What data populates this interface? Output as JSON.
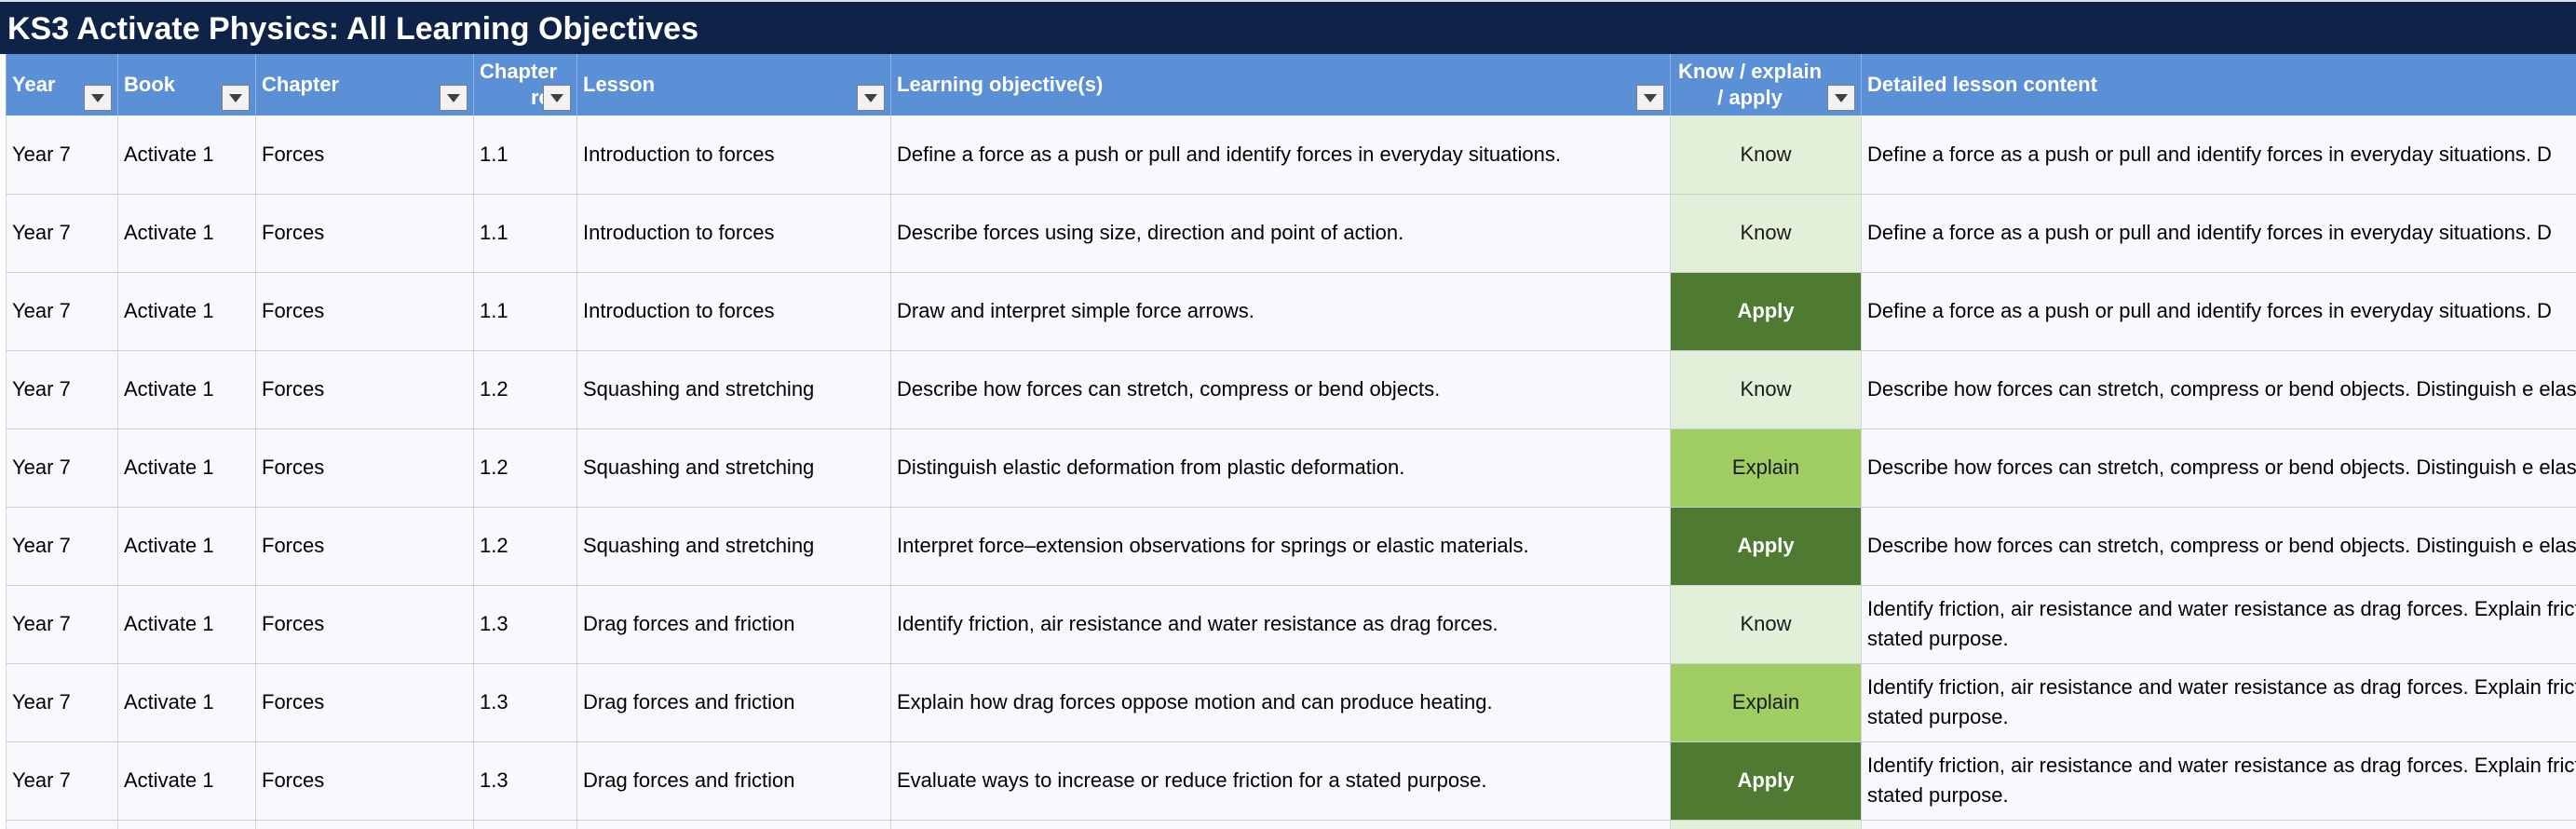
{
  "sheet_title": "KS3 Activate Physics: All Learning Objectives",
  "headers": {
    "year": "Year",
    "book": "Book",
    "chapter": "Chapter",
    "chapter_ref": "Chapter ref",
    "lesson": "Lesson",
    "objective": "Learning objective(s)",
    "kea": "Know / explain / apply",
    "detail": "Detailed lesson content"
  },
  "colors": {
    "title_bg": "#0e2347",
    "header_bg": "#5b8fd6",
    "know_bg": "#e2efd9",
    "explain_bg": "#9fcd63",
    "apply_bg": "#4e7a32"
  },
  "rows": [
    {
      "year": "Year 7",
      "book": "Activate 1",
      "chapter": "Forces",
      "ref": "1.1",
      "lesson": "Introduction to forces",
      "objective": "Define a force as a push or pull and identify forces in everyday situations.",
      "kea": "Know",
      "detail": "Define a force as a push or pull and identify forces in everyday situations. D"
    },
    {
      "year": "Year 7",
      "book": "Activate 1",
      "chapter": "Forces",
      "ref": "1.1",
      "lesson": "Introduction to forces",
      "objective": "Describe forces using size, direction and point of action.",
      "kea": "Know",
      "detail": "Define a force as a push or pull and identify forces in everyday situations. D"
    },
    {
      "year": "Year 7",
      "book": "Activate 1",
      "chapter": "Forces",
      "ref": "1.1",
      "lesson": "Introduction to forces",
      "objective": "Draw and interpret simple force arrows.",
      "kea": "Apply",
      "detail": "Define a force as a push or pull and identify forces in everyday situations. D"
    },
    {
      "year": "Year 7",
      "book": "Activate 1",
      "chapter": "Forces",
      "ref": "1.2",
      "lesson": "Squashing and stretching",
      "objective": "Describe how forces can stretch, compress or bend objects.",
      "kea": "Know",
      "detail": "Describe how forces can stretch, compress or bend objects. Distinguish e elastic materials."
    },
    {
      "year": "Year 7",
      "book": "Activate 1",
      "chapter": "Forces",
      "ref": "1.2",
      "lesson": "Squashing and stretching",
      "objective": "Distinguish elastic deformation from plastic deformation.",
      "kea": "Explain",
      "detail": "Describe how forces can stretch, compress or bend objects. Distinguish e elastic materials."
    },
    {
      "year": "Year 7",
      "book": "Activate 1",
      "chapter": "Forces",
      "ref": "1.2",
      "lesson": "Squashing and stretching",
      "objective": "Interpret force–extension observations for springs or elastic materials.",
      "kea": "Apply",
      "detail": "Describe how forces can stretch, compress or bend objects. Distinguish e elastic materials."
    },
    {
      "year": "Year 7",
      "book": "Activate 1",
      "chapter": "Forces",
      "ref": "1.3",
      "lesson": "Drag forces and friction",
      "objective": "Identify friction, air resistance and water resistance as drag forces.",
      "kea": "Know",
      "detail": "Identify friction, air resistance and water resistance as drag forces. Explain friction for a stated purpose."
    },
    {
      "year": "Year 7",
      "book": "Activate 1",
      "chapter": "Forces",
      "ref": "1.3",
      "lesson": "Drag forces and friction",
      "objective": "Explain how drag forces oppose motion and can produce heating.",
      "kea": "Explain",
      "detail": "Identify friction, air resistance and water resistance as drag forces. Explain friction for a stated purpose."
    },
    {
      "year": "Year 7",
      "book": "Activate 1",
      "chapter": "Forces",
      "ref": "1.3",
      "lesson": "Drag forces and friction",
      "objective": "Evaluate ways to increase or reduce friction for a stated purpose.",
      "kea": "Apply",
      "detail": "Identify friction, air resistance and water resistance as drag forces. Explain friction for a stated purpose."
    }
  ]
}
